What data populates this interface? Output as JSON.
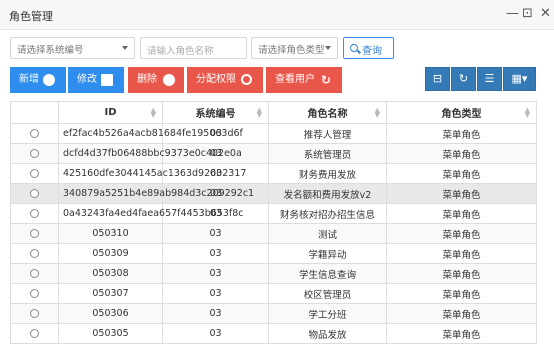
{
  "window": {
    "title": "角色管理",
    "controls": [
      "—",
      "⊡",
      "✕"
    ]
  },
  "filters": {
    "system_select": "请选择系统编号",
    "role_name_placeholder": "请输入角色名称",
    "role_type_select": "请选择角色类型",
    "query_label": "查询"
  },
  "actions": {
    "add": "新增",
    "edit": "修改",
    "delete": "删除",
    "assign": "分配权限",
    "view_users": "查看用户"
  },
  "colors": {
    "blue": "#2e8ded",
    "red": "#e8574a",
    "table_tool_blue": "#337ab7"
  },
  "table": {
    "headers": [
      "ID",
      "系统编号",
      "角色名称",
      "角色类型"
    ],
    "rows": [
      {
        "id": "ef2fac4b526a4acb81684fe195063d6f",
        "sys": "03",
        "name": "推荐人管理",
        "type": "菜单角色"
      },
      {
        "id": "dcfd4d37fb06488bbc9373e0c402e0a",
        "sys": "03",
        "name": "系统管理员",
        "type": "菜单角色"
      },
      {
        "id": "425160dfe3044145ac1363d92602317",
        "sys": "03",
        "name": "财务费用发放",
        "type": "菜单角色"
      },
      {
        "id": "340879a5251b4e89ab984d3c209292c1",
        "sys": "03",
        "name": "发名额和费用发放v2",
        "type": "菜单角色"
      },
      {
        "id": "0a43243fa4ed4faea657f4453b653f8c",
        "sys": "03",
        "name": "财务核对招办招生信息",
        "type": "菜单角色"
      },
      {
        "id": "050310",
        "sys": "03",
        "name": "测试",
        "type": "菜单角色"
      },
      {
        "id": "050309",
        "sys": "03",
        "name": "学籍异动",
        "type": "菜单角色"
      },
      {
        "id": "050308",
        "sys": "03",
        "name": "学生信息查询",
        "type": "菜单角色"
      },
      {
        "id": "050307",
        "sys": "03",
        "name": "校区管理员",
        "type": "菜单角色"
      },
      {
        "id": "050306",
        "sys": "03",
        "name": "学工分班",
        "type": "菜单角色"
      },
      {
        "id": "050305",
        "sys": "03",
        "name": "物品发放",
        "type": "菜单角色"
      }
    ]
  }
}
